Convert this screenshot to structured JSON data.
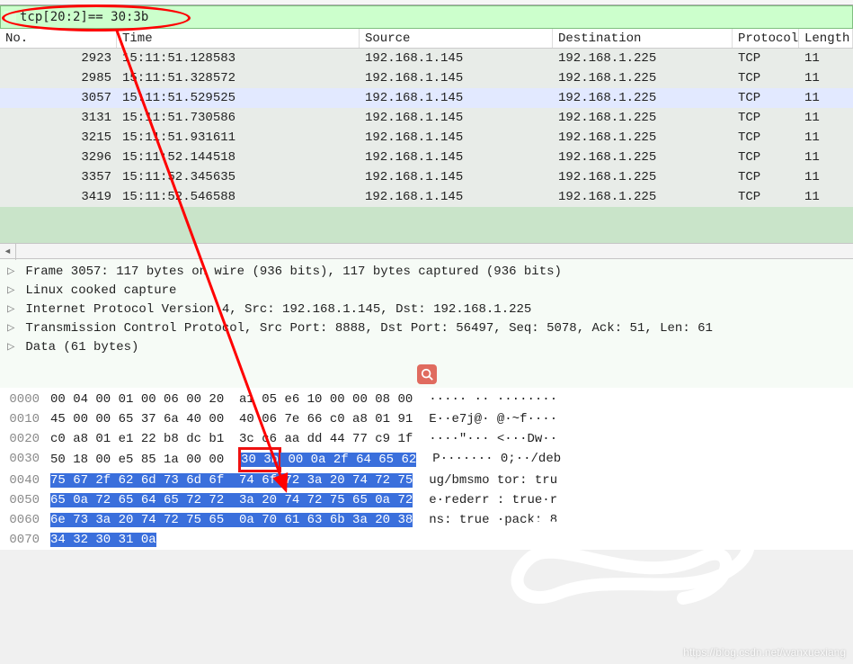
{
  "filter": {
    "expression": "tcp[20:2]== 30:3b"
  },
  "columns": {
    "no": "No.",
    "time": "Time",
    "src": "Source",
    "dst": "Destination",
    "proto": "Protocol",
    "len": "Length"
  },
  "packets": [
    {
      "no": "2923",
      "time": "15:11:51.128583",
      "src": "192.168.1.145",
      "dst": "192.168.1.225",
      "proto": "TCP",
      "len": "11",
      "sel": false
    },
    {
      "no": "2985",
      "time": "15:11:51.328572",
      "src": "192.168.1.145",
      "dst": "192.168.1.225",
      "proto": "TCP",
      "len": "11",
      "sel": false
    },
    {
      "no": "3057",
      "time": "15:11:51.529525",
      "src": "192.168.1.145",
      "dst": "192.168.1.225",
      "proto": "TCP",
      "len": "11",
      "sel": true
    },
    {
      "no": "3131",
      "time": "15:11:51.730586",
      "src": "192.168.1.145",
      "dst": "192.168.1.225",
      "proto": "TCP",
      "len": "11",
      "sel": false
    },
    {
      "no": "3215",
      "time": "15:11:51.931611",
      "src": "192.168.1.145",
      "dst": "192.168.1.225",
      "proto": "TCP",
      "len": "11",
      "sel": false
    },
    {
      "no": "3296",
      "time": "15:11:52.144518",
      "src": "192.168.1.145",
      "dst": "192.168.1.225",
      "proto": "TCP",
      "len": "11",
      "sel": false
    },
    {
      "no": "3357",
      "time": "15:11:52.345635",
      "src": "192.168.1.145",
      "dst": "192.168.1.225",
      "proto": "TCP",
      "len": "11",
      "sel": false
    },
    {
      "no": "3419",
      "time": "15:11:52.546588",
      "src": "192.168.1.145",
      "dst": "192.168.1.225",
      "proto": "TCP",
      "len": "11",
      "sel": false
    }
  ],
  "details": [
    "Frame 3057: 117 bytes on wire (936 bits), 117 bytes captured (936 bits)",
    "Linux cooked capture",
    "Internet Protocol Version 4, Src: 192.168.1.145, Dst: 192.168.1.225",
    "Transmission Control Protocol, Src Port: 8888, Dst Port: 56497, Seq: 5078, Ack: 51, Len: 61",
    "Data (61 bytes)"
  ],
  "hex": {
    "rows": [
      {
        "off": "0000",
        "b1": "00 04 00 01 00 06 00 20",
        "b2": "a1 05 e6 10 00 00 08 00",
        "a": "····· ·· ········",
        "hi": 0
      },
      {
        "off": "0010",
        "b1": "45 00 00 65 37 6a 40 00",
        "b2": "40 06 7e 66 c0 a8 01 91",
        "a": "E··e7j@· @·~f····",
        "hi": 0
      },
      {
        "off": "0020",
        "b1": "c0 a8 01 e1 22 b8 dc b1",
        "b2": "3c c6 aa dd 44 77 c9 1f",
        "a": "····\"··· <···Dw··",
        "hi": 0
      },
      {
        "off": "0030",
        "b1": "50 18 00 e5 85 1a 00 00",
        "b2box": "30 3b",
        "b2rest": " 00 0a 2f 64 65 62",
        "a": "P······· 0;··/deb",
        "hi": 1
      },
      {
        "off": "0040",
        "b1": "75 67 2f 62 6d 73 6d 6f",
        "b2": "74 6f 72 3a 20 74 72 75",
        "a": "ug/bmsmo tor: tru",
        "hi": 2
      },
      {
        "off": "0050",
        "b1": "65 0a 72 65 64 65 72 72",
        "b2": "3a 20 74 72 75 65 0a 72",
        "a": "e·rederr : true·r",
        "hi": 2
      },
      {
        "off": "0060",
        "b1": "6e 73 3a 20 74 72 75 65",
        "b2": "0a 70 61 63 6b 3a 20 38",
        "a": "ns: true ·pack: 8",
        "hi": 2
      },
      {
        "off": "0070",
        "b1": "34 32 30 31 0a",
        "b2": "",
        "a": "",
        "hi": 2
      }
    ]
  },
  "watermark": "https://blog.csdn.net/wanxuexiang"
}
